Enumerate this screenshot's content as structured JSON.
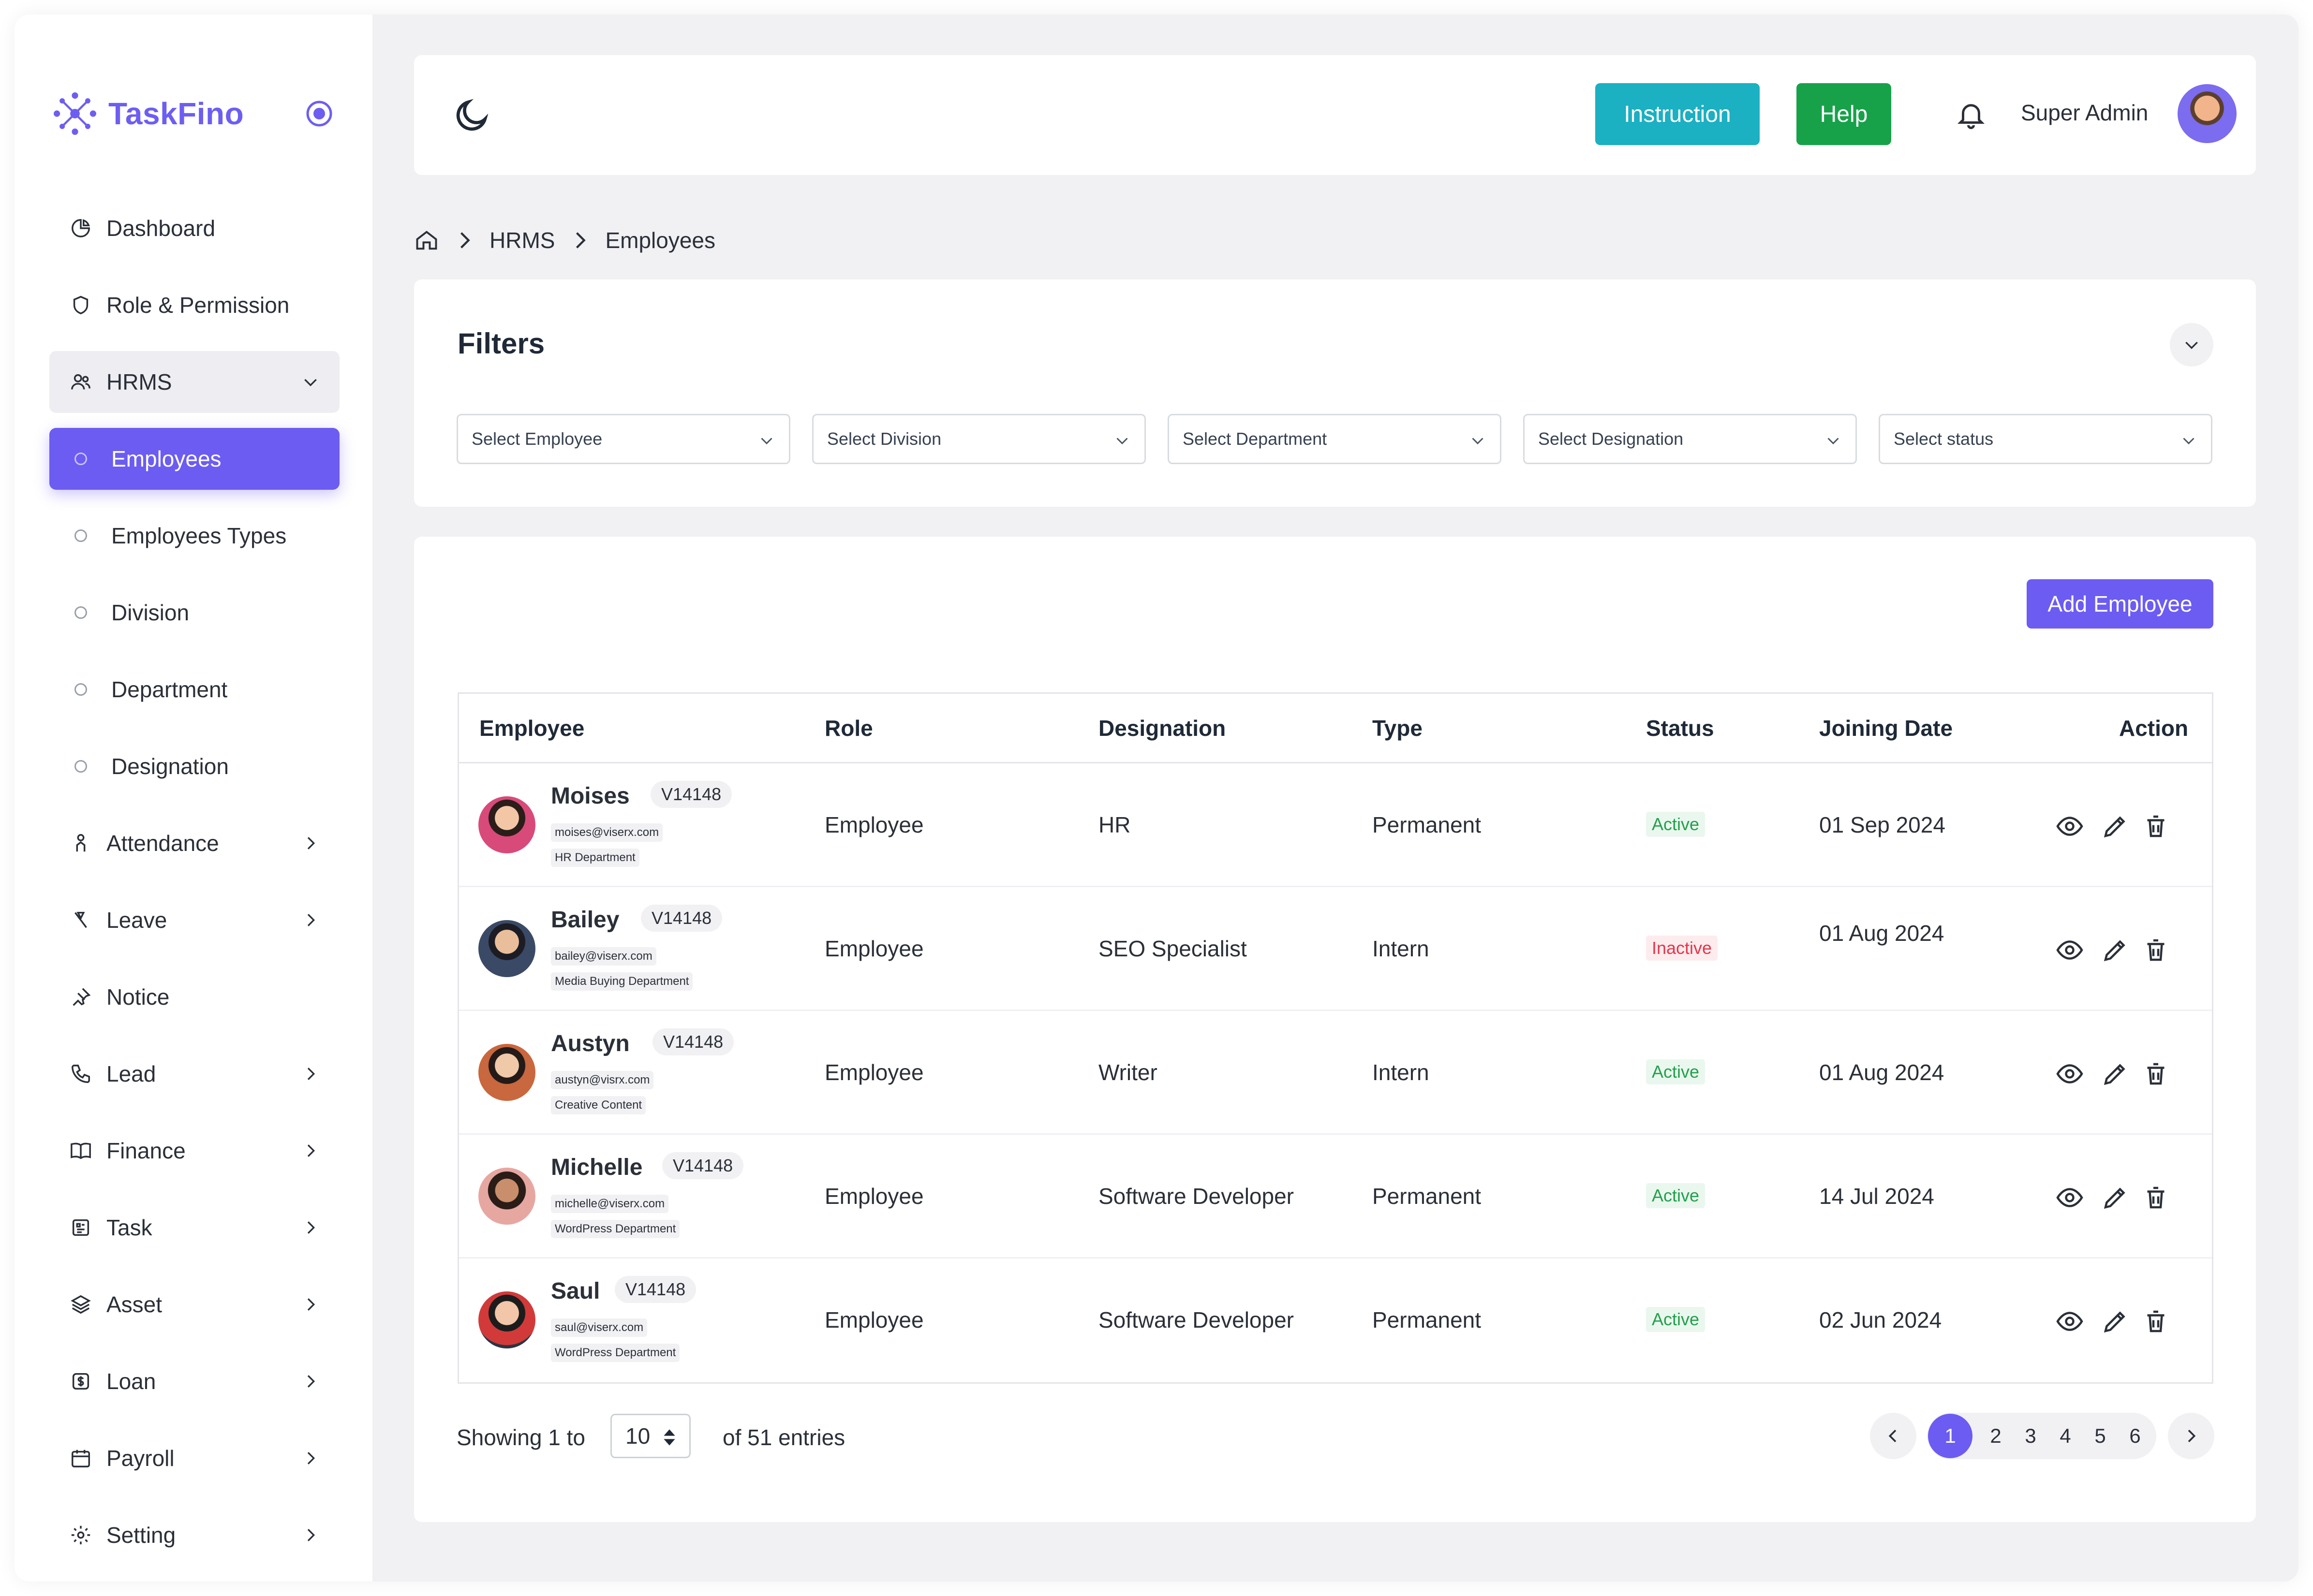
{
  "brand": {
    "name": "TaskFino"
  },
  "sidebar": {
    "items": [
      {
        "label": "Dashboard",
        "icon": "pie-chart-icon"
      },
      {
        "label": "Role & Permission",
        "icon": "shield-icon"
      },
      {
        "label": "HRMS",
        "icon": "users-icon",
        "expanded": true
      },
      {
        "label": "Employees",
        "sub": true,
        "active": true
      },
      {
        "label": "Employees Types",
        "sub": true
      },
      {
        "label": "Division",
        "sub": true
      },
      {
        "label": "Department",
        "sub": true
      },
      {
        "label": "Designation",
        "sub": true
      },
      {
        "label": "Attendance",
        "icon": "person-icon"
      },
      {
        "label": "Leave",
        "icon": "leave-icon"
      },
      {
        "label": "Notice",
        "icon": "pin-icon"
      },
      {
        "label": "Lead",
        "icon": "phone-icon"
      },
      {
        "label": "Finance",
        "icon": "book-icon"
      },
      {
        "label": "Task",
        "icon": "task-icon"
      },
      {
        "label": "Asset",
        "icon": "layers-icon"
      },
      {
        "label": "Loan",
        "icon": "loan-icon"
      },
      {
        "label": "Payroll",
        "icon": "calendar-icon"
      },
      {
        "label": "Setting",
        "icon": "gear-icon"
      }
    ]
  },
  "header": {
    "instruction_label": "Instruction",
    "help_label": "Help",
    "user_name": "Super Admin"
  },
  "breadcrumb": {
    "items": [
      "HRMS",
      "Employees"
    ]
  },
  "filters": {
    "title": "Filters",
    "selects": [
      "Select Employee",
      "Select Division",
      "Select Department",
      "Select Designation",
      "Select status"
    ]
  },
  "table": {
    "add_label": "Add Employee",
    "columns": [
      "Employee",
      "Role",
      "Designation",
      "Type",
      "Status",
      "Joining Date",
      "Action"
    ],
    "rows": [
      {
        "name": "Moises",
        "code": "V14148",
        "email": "moises@viserx.com",
        "dept": "HR Department",
        "role": "Employee",
        "designation": "HR",
        "type": "Permanent",
        "status": "Active",
        "date": "01 Sep 2024"
      },
      {
        "name": "Bailey",
        "code": "V14148",
        "email": "bailey@viserx.com",
        "dept": "Media Buying Department",
        "role": "Employee",
        "designation": "SEO Specialist",
        "type": "Intern",
        "status": "Inactive",
        "date": "01 Aug 2024"
      },
      {
        "name": "Austyn",
        "code": "V14148",
        "email": "austyn@visrx.com",
        "dept": "Creative Content",
        "role": "Employee",
        "designation": "Writer",
        "type": "Intern",
        "status": "Active",
        "date": "01 Aug 2024"
      },
      {
        "name": "Michelle",
        "code": "V14148",
        "email": "michelle@viserx.com",
        "dept": "WordPress Department",
        "role": "Employee",
        "designation": "Software Developer",
        "type": "Permanent",
        "status": "Active",
        "date": "14 Jul 2024"
      },
      {
        "name": "Saul",
        "code": "V14148",
        "email": "saul@viserx.com",
        "dept": "WordPress Department",
        "role": "Employee",
        "designation": "Software Developer",
        "type": "Permanent",
        "status": "Active",
        "date": "02 Jun 2024"
      }
    ]
  },
  "pagination": {
    "showing_prefix": "Showing 1 to",
    "per_page": "10",
    "showing_suffix": "of 51 entries",
    "pages": [
      "1",
      "2",
      "3",
      "4",
      "5",
      "6"
    ],
    "current": "1"
  },
  "colors": {
    "accent": "#6c5cf2",
    "instruction": "#1bb0c2",
    "help": "#17a24a",
    "active": "#22a04b",
    "inactive": "#e2374b"
  }
}
